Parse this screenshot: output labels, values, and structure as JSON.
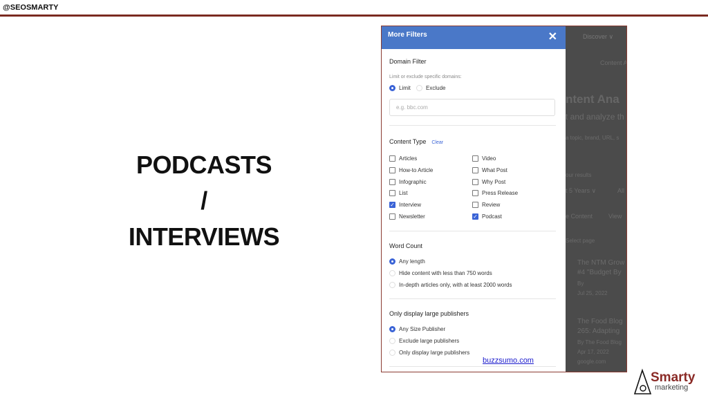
{
  "slide": {
    "handle": "@SEOSMARTY",
    "title_lines": [
      "PODCASTS",
      "/",
      "INTERVIEWS"
    ],
    "source_link": "buzzsumo.com",
    "logo": {
      "text": "Smarty",
      "sub": "marketing"
    }
  },
  "background_app": {
    "nav": "Discover ∨",
    "tab": "Content A",
    "heading": "ntent Ana",
    "subheading": "t and analyze th",
    "search_hint": "a topic, brand, URL, s",
    "results_label": "our results",
    "date_filter": "t 5 Years ∨",
    "all": "All",
    "tab2": "e Content",
    "tab3": "View",
    "select_page": "Select page",
    "results": [
      {
        "title1": "The NTM Grow",
        "title2": "#4 \"Budget By",
        "by": "By",
        "date": "Jul 25, 2022"
      },
      {
        "title1": "The Food Blog",
        "title2": "265: Adapting",
        "by": "By The Food Blog",
        "date": "Apr 17, 2022",
        "domain": "google.com"
      }
    ]
  },
  "modal": {
    "title": "More Filters",
    "close_icon": "close-icon",
    "domain_filter": {
      "title": "Domain Filter",
      "hint": "Limit or exclude specific domains:",
      "options": [
        {
          "label": "Limit",
          "selected": true
        },
        {
          "label": "Exclude",
          "selected": false
        }
      ],
      "placeholder": "e.g. bbc.com"
    },
    "content_type": {
      "title": "Content Type",
      "clear": "Clear",
      "items": [
        {
          "label": "Articles",
          "checked": false
        },
        {
          "label": "Video",
          "checked": false
        },
        {
          "label": "How-to Article",
          "checked": false
        },
        {
          "label": "What Post",
          "checked": false
        },
        {
          "label": "Infographic",
          "checked": false
        },
        {
          "label": "Why Post",
          "checked": false
        },
        {
          "label": "List",
          "checked": false
        },
        {
          "label": "Press Release",
          "checked": false
        },
        {
          "label": "Interview",
          "checked": true
        },
        {
          "label": "Review",
          "checked": false
        },
        {
          "label": "Newsletter",
          "checked": false
        },
        {
          "label": "Podcast",
          "checked": true
        }
      ]
    },
    "word_count": {
      "title": "Word Count",
      "options": [
        {
          "label": "Any length",
          "selected": true
        },
        {
          "label": "Hide content with less than 750 words",
          "selected": false
        },
        {
          "label": "In-depth articles only, with at least 2000 words",
          "selected": false
        }
      ]
    },
    "publishers": {
      "title": "Only display large publishers",
      "options": [
        {
          "label": "Any Size Publisher",
          "selected": true
        },
        {
          "label": "Exclude large publishers",
          "selected": false
        },
        {
          "label": "Only display large publishers",
          "selected": false
        }
      ]
    }
  },
  "colors": {
    "accent": "#4a78c8",
    "brand": "#7a2a20",
    "check": "#3a63d6"
  }
}
